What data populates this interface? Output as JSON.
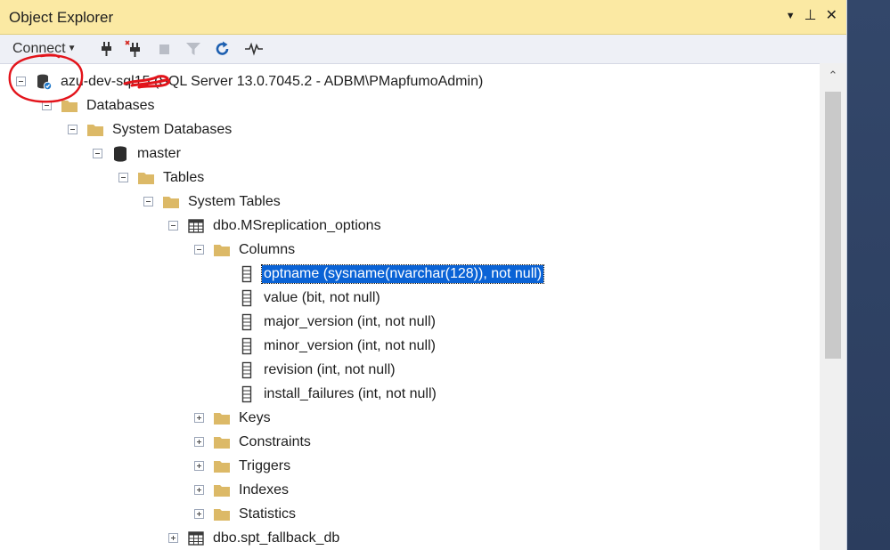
{
  "window": {
    "title": "Object Explorer",
    "pin_glyph": "⊥",
    "close_glyph": "✕",
    "dropdown_glyph": "▼"
  },
  "toolbar": {
    "connect_label": "Connect",
    "icons": [
      "connect-icon",
      "disconnect-icon",
      "stop-icon",
      "filter-icon",
      "refresh-icon",
      "activity-monitor-icon"
    ]
  },
  "tree": {
    "server": "azu-dev-sql15 (SQL Server 13.0.7045.2 - ADBM\\PMapfumoAdmin)",
    "databases": "Databases",
    "system_databases": "System Databases",
    "master": "master",
    "tables": "Tables",
    "system_tables": "System Tables",
    "table": "dbo.MSreplication_options",
    "columns": "Columns",
    "column_items": [
      "optname (sysname(nvarchar(128)), not null)",
      "value (bit, not null)",
      "major_version (int, not null)",
      "minor_version (int, not null)",
      "revision (int, not null)",
      "install_failures (int, not null)"
    ],
    "keys": "Keys",
    "constraints": "Constraints",
    "triggers": "Triggers",
    "indexes": "Indexes",
    "statistics": "Statistics",
    "next_table": "dbo.spt_fallback_db"
  },
  "colors": {
    "accent": "#0a63d6",
    "title_bar": "#fbe9a3",
    "folder": "#dcb967",
    "annotation": "#e3141b"
  },
  "scrollbar": {
    "up_glyph": "⌃"
  }
}
